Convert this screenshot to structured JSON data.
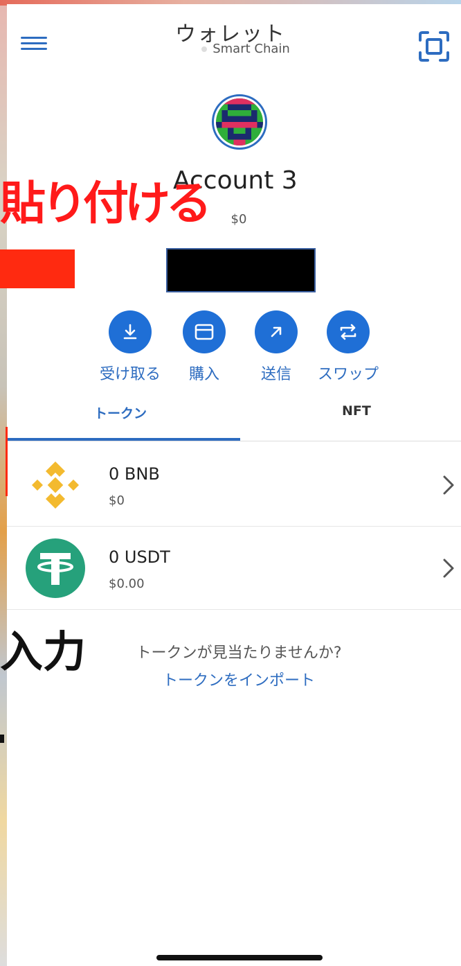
{
  "header": {
    "title": "ウォレット",
    "network": "Smart Chain"
  },
  "account": {
    "name": "Account 3",
    "balance": "$0"
  },
  "actions": [
    {
      "label": "受け取る",
      "icon": "download-icon"
    },
    {
      "label": "購入",
      "icon": "card-icon"
    },
    {
      "label": "送信",
      "icon": "send-arrow-icon"
    },
    {
      "label": "スワップ",
      "icon": "swap-icon"
    }
  ],
  "tabs": [
    {
      "label": "トークン",
      "active": true
    },
    {
      "label": "NFT",
      "active": false
    }
  ],
  "tokens": [
    {
      "amount": "0 BNB",
      "value": "$0",
      "icon": "bnb-logo-icon",
      "color": "#f3ba2f"
    },
    {
      "amount": "0 USDT",
      "value": "$0.00",
      "icon": "usdt-logo-icon",
      "color": "#26a17b"
    }
  ],
  "footer": {
    "prompt": "トークンが見当たりませんか?",
    "import_link": "トークンをインポート"
  },
  "overlay": {
    "paste_text": "貼り付ける",
    "input_text": "入力"
  },
  "colors": {
    "accent": "#2d6cc0",
    "button": "#1f6fd6",
    "overlay_red": "#ff1a1a"
  }
}
